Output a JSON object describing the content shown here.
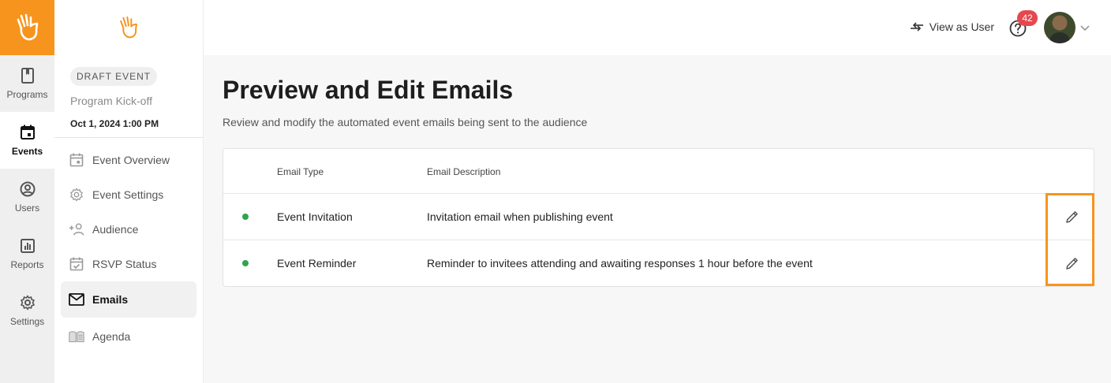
{
  "colors": {
    "brand": "#f7941d",
    "status_active": "#2ea44f",
    "badge": "#e5484d"
  },
  "rail": {
    "items": [
      {
        "label": "Programs",
        "icon": "bookmark-icon"
      },
      {
        "label": "Events",
        "icon": "calendar-icon",
        "active": true
      },
      {
        "label": "Users",
        "icon": "user-circle-icon"
      },
      {
        "label": "Reports",
        "icon": "bar-chart-icon"
      },
      {
        "label": "Settings",
        "icon": "gear-icon"
      }
    ]
  },
  "event": {
    "badge": "DRAFT EVENT",
    "name": "Program Kick-off",
    "date": "Oct 1, 2024 1:00 PM"
  },
  "sidenav": {
    "items": [
      {
        "label": "Event Overview",
        "icon": "calendar-icon"
      },
      {
        "label": "Event Settings",
        "icon": "gear-icon"
      },
      {
        "label": "Audience",
        "icon": "add-user-icon"
      },
      {
        "label": "RSVP Status",
        "icon": "calendar-check-icon"
      },
      {
        "label": "Emails",
        "icon": "mail-icon",
        "active": true
      },
      {
        "label": "Agenda",
        "icon": "book-open-icon"
      }
    ]
  },
  "topbar": {
    "view_as_user": "View as User",
    "help_badge_count": "42"
  },
  "main": {
    "title": "Preview and Edit Emails",
    "subtitle": "Review and modify the automated event emails being sent to the audience"
  },
  "table": {
    "headers": {
      "email_type": "Email Type",
      "email_description": "Email Description"
    },
    "rows": [
      {
        "type": "Event Invitation",
        "description": "Invitation email when publishing event",
        "status": "active"
      },
      {
        "type": "Event Reminder",
        "description": "Reminder to invitees attending and awaiting responses 1 hour before the event",
        "status": "active"
      }
    ]
  }
}
